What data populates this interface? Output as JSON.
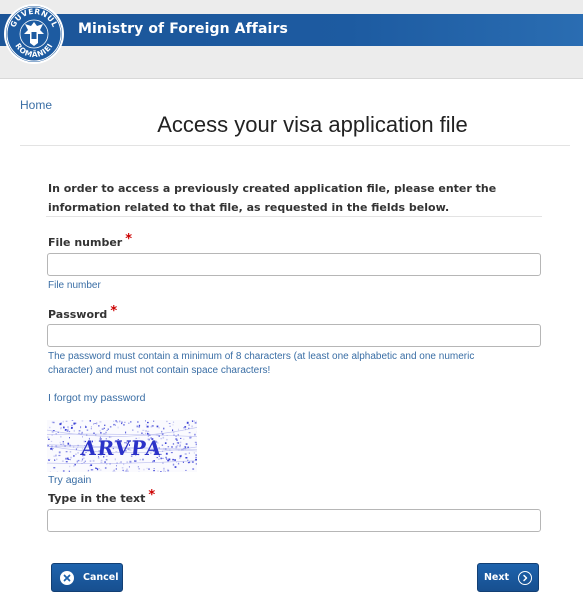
{
  "header": {
    "seal_text": "GUVERNUL ROMÂNIEI",
    "title": "Ministry of Foreign Affairs"
  },
  "breadcrumb": {
    "home": "Home"
  },
  "page": {
    "title": "Access your visa application file",
    "intro": "In order to access a previously created application file, please enter the information related to that file, as requested in the fields below."
  },
  "form": {
    "file_number": {
      "label": "File number",
      "required_mark": "*",
      "value": "",
      "help": "File number"
    },
    "password": {
      "label": "Password",
      "required_mark": "*",
      "value": "",
      "help": "The password must contain a minimum of 8 characters (at least one alphabetic and one numeric character) and must not contain space characters!"
    },
    "forgot_password": "I forgot my password",
    "captcha": {
      "text": "ARVPA",
      "retry": "Try again",
      "label": "Type in the text",
      "required_mark": "*",
      "value": ""
    }
  },
  "buttons": {
    "cancel": "Cancel",
    "next": "Next"
  },
  "colors": {
    "banner": "#1d5ba1",
    "link": "#3a6ea5",
    "required": "#cc0000",
    "button": "#1e63ad"
  }
}
